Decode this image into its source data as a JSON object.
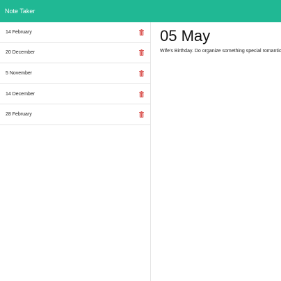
{
  "app": {
    "title": "Note Taker"
  },
  "colors": {
    "accent": "#20b894",
    "danger": "#d9534f"
  },
  "notes": [
    {
      "title": "14 February",
      "delete_icon": "trash-icon"
    },
    {
      "title": "20 December",
      "delete_icon": "trash-icon"
    },
    {
      "title": "5 November",
      "delete_icon": "trash-icon"
    },
    {
      "title": "14 December",
      "delete_icon": "trash-icon"
    },
    {
      "title": "28 February",
      "delete_icon": "trash-icon"
    }
  ],
  "active_note": {
    "title": "05 May",
    "text": "Wife's Birthday. Do organize something special romantic!!!"
  }
}
